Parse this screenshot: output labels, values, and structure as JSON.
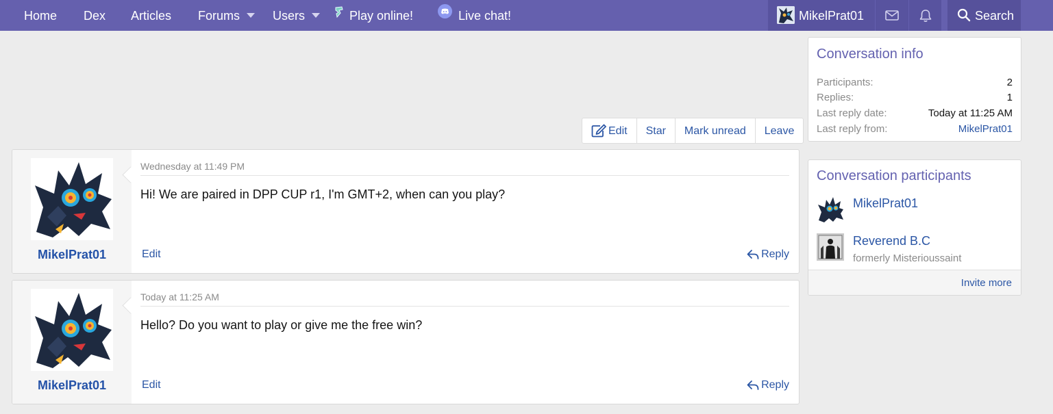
{
  "nav": {
    "items": [
      {
        "label": "Home"
      },
      {
        "label": "Dex"
      },
      {
        "label": "Articles"
      },
      {
        "label": "Forums"
      },
      {
        "label": "Users"
      },
      {
        "label": "Play online!"
      },
      {
        "label": "Live chat!"
      }
    ],
    "username": "MikelPrat01",
    "search_label": "Search"
  },
  "toolbar": {
    "edit": "Edit",
    "star": "Star",
    "mark_unread": "Mark unread",
    "leave": "Leave"
  },
  "messages": [
    {
      "author": "MikelPrat01",
      "date": "Wednesday at 11:49 PM",
      "body": "Hi! We are paired in DPP CUP r1, I'm GMT+2, when can you play?",
      "edit": "Edit",
      "reply": "Reply"
    },
    {
      "author": "MikelPrat01",
      "date": "Today at 11:25 AM",
      "body": "Hello? Do you want to play or give me the free win?",
      "edit": "Edit",
      "reply": "Reply"
    }
  ],
  "info": {
    "title": "Conversation info",
    "rows": [
      {
        "label": "Participants:",
        "value": "2"
      },
      {
        "label": "Replies:",
        "value": "1"
      },
      {
        "label": "Last reply date:",
        "value": "Today at 11:25 AM"
      },
      {
        "label": "Last reply from:",
        "value": "MikelPrat01"
      }
    ]
  },
  "participants": {
    "title": "Conversation participants",
    "list": [
      {
        "name": "MikelPrat01",
        "sub": ""
      },
      {
        "name": "Reverend B.C",
        "sub": "formerly Misterioussaint"
      }
    ],
    "invite": "Invite more"
  },
  "colors": {
    "nav_bg": "#6560ae",
    "link": "#2b56a5",
    "sidebar_title": "#6462b0"
  }
}
